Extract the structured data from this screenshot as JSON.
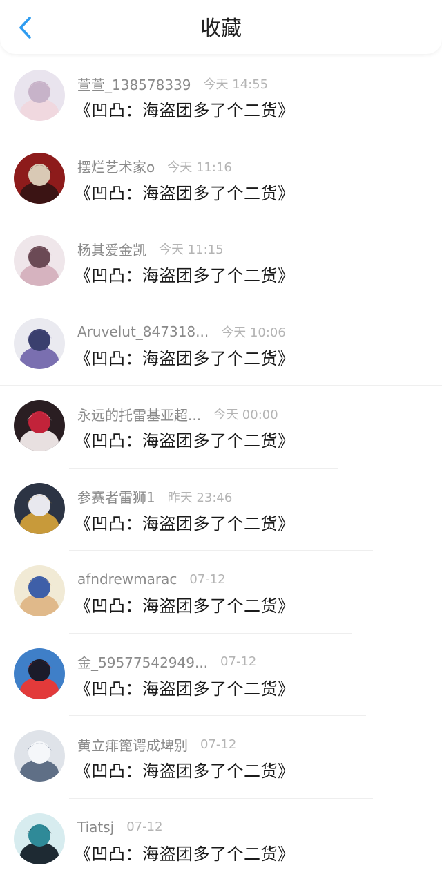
{
  "header": {
    "title": "收藏",
    "back_icon": "chevron-left-icon",
    "accent_color": "#2f9cf0"
  },
  "items": [
    {
      "username": "萱萱_138578339",
      "time": "今天 14:55",
      "content": "《凹凸：海盗团多了个二货》",
      "avatar": {
        "bg": "#e9e4ee",
        "fg": "#c7b3c9",
        "accent": "#f0d8df"
      }
    },
    {
      "username": "摆烂艺术家o",
      "time": "今天 11:16",
      "content": "《凹凸：海盗团多了个二货》",
      "avatar": {
        "bg": "#8d1b1b",
        "fg": "#d9c9b5",
        "accent": "#3b1414"
      }
    },
    {
      "username": "杨其爱金凯",
      "time": "今天 11:15",
      "content": "《凹凸：海盗团多了个二货》",
      "avatar": {
        "bg": "#efe6ea",
        "fg": "#6b4a55",
        "accent": "#d6b3bf"
      }
    },
    {
      "username": "Aruvelut_847318...",
      "time": "今天 10:06",
      "content": "《凹凸：海盗团多了个二货》",
      "avatar": {
        "bg": "#eaeaf0",
        "fg": "#3a3f6e",
        "accent": "#7a6fb0"
      }
    },
    {
      "username": "永远的托雷基亚超...",
      "time": "今天 00:00",
      "content": "《凹凸：海盗团多了个二货》",
      "avatar": {
        "bg": "#2a1e22",
        "fg": "#c2233a",
        "accent": "#e8e0e0"
      }
    },
    {
      "username": "参赛者雷狮1",
      "time": "昨天 23:46",
      "content": "《凹凸：海盗团多了个二货》",
      "avatar": {
        "bg": "#2c3444",
        "fg": "#e8e8ee",
        "accent": "#c89a3a"
      }
    },
    {
      "username": "afndrewmarac",
      "time": "07-12",
      "content": "《凹凸：海盗团多了个二货》",
      "avatar": {
        "bg": "#f1ead5",
        "fg": "#3e5fa8",
        "accent": "#e0b98a"
      }
    },
    {
      "username": "金_59577542949...",
      "time": "07-12",
      "content": "《凹凸：海盗团多了个二货》",
      "avatar": {
        "bg": "#3f7fc8",
        "fg": "#1b1b2a",
        "accent": "#e23a3a"
      }
    },
    {
      "username": "黄立痱篦谔成埤别",
      "time": "07-12",
      "content": "《凹凸：海盗团多了个二货》",
      "avatar": {
        "bg": "#dfe3e9",
        "fg": "#f5f7fa",
        "accent": "#5f6f86"
      }
    },
    {
      "username": "Tiatsj",
      "time": "07-12",
      "content": "《凹凸：海盗团多了个二货》",
      "avatar": {
        "bg": "#d7ecef",
        "fg": "#2f8a98",
        "accent": "#1e2a33"
      }
    }
  ]
}
